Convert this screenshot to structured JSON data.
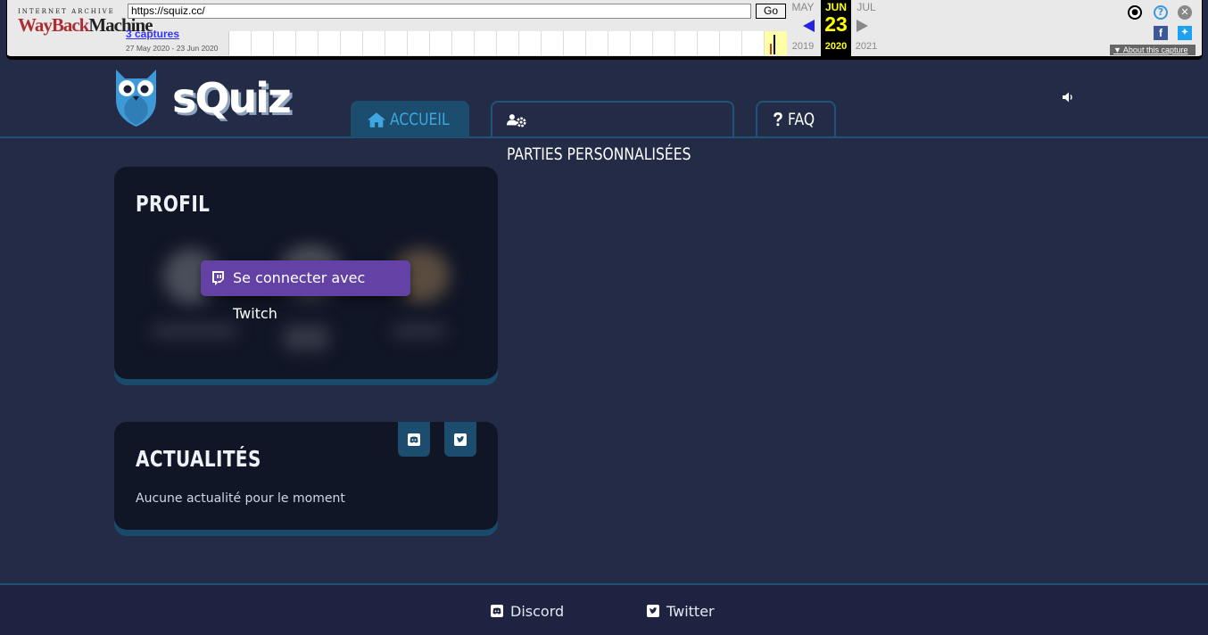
{
  "wayback": {
    "logo_top": "INTERNET ARCHIVE",
    "logo_wayback": "WayBack",
    "logo_machine": "Machine",
    "url": "https://squiz.cc/",
    "go_label": "Go",
    "captures_label": "3 captures",
    "date_range": "27 May 2020 - 23 Jun 2020",
    "prev_month": "MAY",
    "cur_month": "JUN",
    "cur_day": "23",
    "next_month": "JUL",
    "prev_year": "2019",
    "cur_year": "2020",
    "next_year": "2021",
    "about_label": "About this capture",
    "icons": [
      "user-icon",
      "help-icon",
      "close-icon",
      "facebook-icon",
      "twitter-icon"
    ]
  },
  "header": {
    "brand": "sQuiz",
    "tabs": [
      {
        "label": "ACCUEIL",
        "icon": "home-icon",
        "active": true
      },
      {
        "label": "PARTIES PERSONNALISÉES",
        "icon": "users-gear-icon",
        "active": false
      },
      {
        "label": "FAQ",
        "icon": "question-icon",
        "active": false
      }
    ],
    "volume_icon": "volume-icon"
  },
  "profile": {
    "title": "PROFIL",
    "twitch_button": "Se connecter avec Twitch"
  },
  "news": {
    "title": "ACTUALITÉS",
    "empty_text": "Aucune actualité pour le moment",
    "social_icons": [
      "discord-icon",
      "twitter-icon"
    ]
  },
  "footer": {
    "links": [
      "Discord",
      "Twitter"
    ]
  },
  "colors": {
    "background": "#242b47",
    "card": "#111626",
    "accent": "#3fa7e0",
    "twitch": "#6441a5",
    "tab_active": "#1c4c6e"
  }
}
